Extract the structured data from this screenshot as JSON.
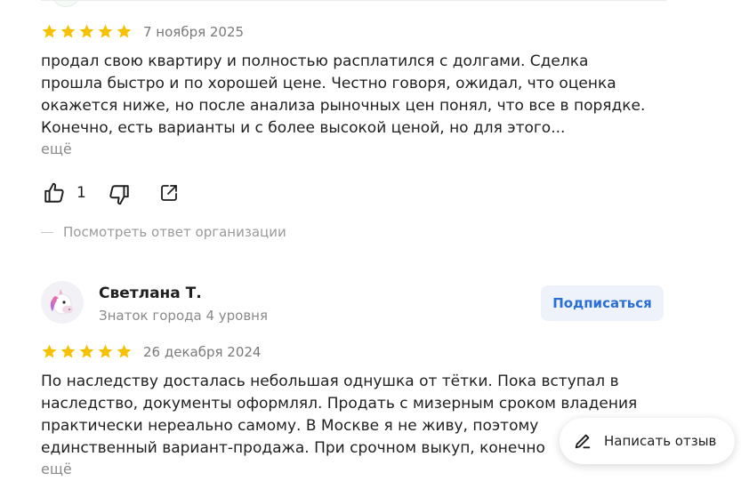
{
  "colors": {
    "star": "#f6c100",
    "accent": "#2a6fd6",
    "muted": "#8a8a8a"
  },
  "reviews": [
    {
      "rating": 5,
      "date": "7 ноября 2025",
      "text": [
        "продал свою квартиру и полностью расплатился с долгами. Сделка",
        "прошла быстро и по хорошей цене. Честно говоря, ожидал, что оценка",
        "окажется ниже, но после анализа рыночных цен понял, что все в порядке.",
        "Конечно, есть варианты и с более высокой ценой, но для этого..."
      ],
      "more_label": "ещё",
      "likes": "1",
      "icons": [
        "thumbs-up-icon",
        "thumbs-down-icon",
        "share-icon"
      ],
      "org_reply_label": "Посмотреть ответ организации"
    },
    {
      "author": "Светлана Т.",
      "level": "Знаток города 4 уровня",
      "avatar_icon": "unicorn-icon",
      "subscribe_label": "Подписаться",
      "rating": 5,
      "date": "26 декабря 2024",
      "text": [
        "По наследству досталась небольшая однушка от тётки. Пока вступал в",
        "наследство, документы оформлял. Продать с мизерным сроком владения",
        "практически нереально самому. В Москве я не живу, поэтому",
        "единственный вариант-продажа. При срочном выкуп, конечно"
      ],
      "more_label": "ещё"
    }
  ],
  "write_review": {
    "label": "Написать отзыв",
    "icon": "pencil-icon"
  }
}
